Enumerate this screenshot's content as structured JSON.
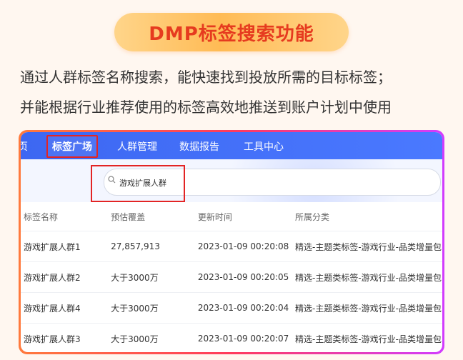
{
  "banner": {
    "title": "DMP标签搜索功能"
  },
  "description": {
    "line1": "通过人群标签名称搜索，能快速找到投放所需的目标标签；",
    "line2": "并能根据行业推荐使用的标签高效地推送到账户计划中使用"
  },
  "nav": {
    "partial": "页",
    "items": [
      "标签广场",
      "人群管理",
      "数据报告",
      "工具中心"
    ],
    "active": "标签广场"
  },
  "search": {
    "value": "游戏扩展人群",
    "icon": "search-icon"
  },
  "table": {
    "headers": [
      "标签名称",
      "预估覆盖",
      "更新时间",
      "所属分类"
    ],
    "rows": [
      [
        "游戏扩展人群1",
        "27,857,913",
        "2023-01-09 00:20:08",
        "精选-主题类标签-游戏行业-品类增量包"
      ],
      [
        "游戏扩展人群2",
        "大于3000万",
        "2023-01-09 00:20:05",
        "精选-主题类标签-游戏行业-品类增量包"
      ],
      [
        "游戏扩展人群4",
        "大于3000万",
        "2023-01-09 00:20:04",
        "精选-主题类标签-游戏行业-品类增量包"
      ],
      [
        "游戏扩展人群3",
        "大于3000万",
        "2023-01-09 00:20:07",
        "精选-主题类标签-游戏行业-品类增量包"
      ]
    ]
  },
  "colors": {
    "accent": "#3d67f2",
    "highlight": "#e32424",
    "title": "#e63b1f"
  }
}
